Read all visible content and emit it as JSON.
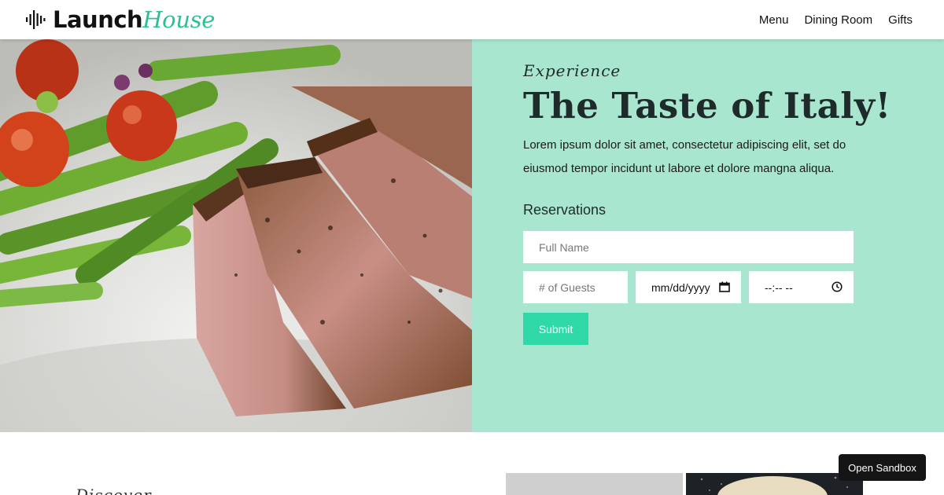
{
  "brand": {
    "name_bold": "Launch",
    "name_italic": "House",
    "icon": "sound-wave-icon",
    "accent": "#2fbf95"
  },
  "nav": {
    "items": [
      {
        "label": "Menu"
      },
      {
        "label": "Dining Room"
      },
      {
        "label": "Gifts"
      }
    ]
  },
  "hero": {
    "image": "steak-asparagus-photo",
    "eyebrow": "Experience",
    "title": "The Taste of Italy!",
    "lead": "Lorem ipsum dolor sit amet, consectetur adipiscing elit, set do eiusmod tempor incidunt ut labore et dolore mangna aliqua.",
    "panel_color": "#a8e6cf"
  },
  "reservations": {
    "heading": "Reservations",
    "name_placeholder": "Full Name",
    "guests_placeholder": "# of Guests",
    "date_value": "mm/dd/yyyy",
    "time_value": "--:-- --",
    "submit_label": "Submit",
    "submit_color": "#2ed8a7"
  },
  "section": {
    "eyebrow": "Discover"
  },
  "sandbox": {
    "label": "Open Sandbox"
  }
}
